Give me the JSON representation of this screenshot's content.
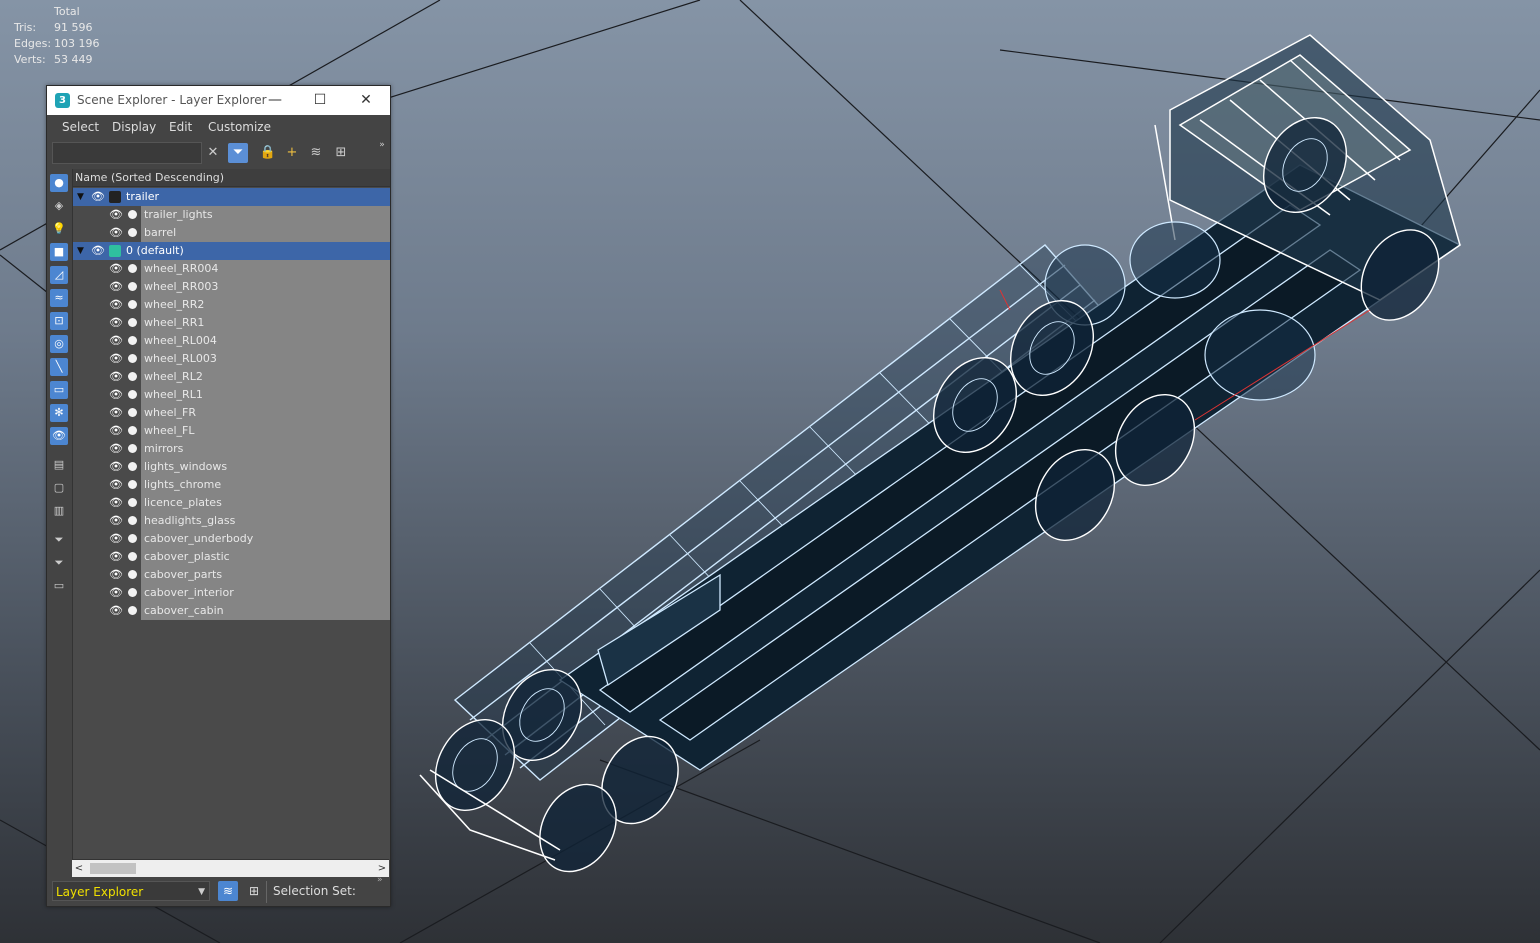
{
  "stats": {
    "header": "Total",
    "rows": [
      {
        "label": "Tris:",
        "value": "91 596"
      },
      {
        "label": "Edges:",
        "value": "103 196"
      },
      {
        "label": "Verts:",
        "value": "53 449"
      }
    ]
  },
  "window": {
    "app_icon_glyph": "3",
    "title": "Scene Explorer - Layer Explorer",
    "minimize_glyph": "—",
    "maximize_glyph": "☐",
    "close_glyph": "✕"
  },
  "menu": [
    "Select",
    "Display",
    "Edit",
    "Customize"
  ],
  "toolbar": {
    "clear_glyph": "✕",
    "filter_glyph": "⏷",
    "lock_glyph": "🔒",
    "add_glyph": "+",
    "layers_glyph": "≋",
    "hierarchy_glyph": "⊞",
    "more_glyph": "»"
  },
  "left_strip": [
    {
      "icon": "geometry-icon",
      "glyph": "●",
      "on": true
    },
    {
      "icon": "shapes-icon",
      "glyph": "◈",
      "on": false
    },
    {
      "icon": "lights-icon",
      "glyph": "💡",
      "on": false
    },
    {
      "icon": "cameras-icon",
      "glyph": "■",
      "on": true
    },
    {
      "icon": "helpers-icon",
      "glyph": "◿",
      "on": true
    },
    {
      "icon": "spacewarps-icon",
      "glyph": "≈",
      "on": true
    },
    {
      "icon": "groups-icon",
      "glyph": "⊡",
      "on": true
    },
    {
      "icon": "xrefs-icon",
      "glyph": "◎",
      "on": true
    },
    {
      "icon": "bones-icon",
      "glyph": "╲",
      "on": true
    },
    {
      "icon": "containers-icon",
      "glyph": "▭",
      "on": true
    },
    {
      "icon": "frozen-icon",
      "glyph": "✻",
      "on": true
    },
    {
      "icon": "hidden-icon",
      "glyph": "👁",
      "on": true
    },
    {
      "icon": "display-all-icon",
      "glyph": "▤",
      "on": false
    },
    {
      "icon": "display-none-icon",
      "glyph": "▢",
      "on": false
    },
    {
      "icon": "invert-icon",
      "glyph": "▥",
      "on": false
    },
    {
      "icon": "filter-settings-icon",
      "glyph": "⏷",
      "on": false
    },
    {
      "icon": "filter-icon",
      "glyph": "⏷",
      "on": false
    },
    {
      "icon": "selection-set-icon",
      "glyph": "▭",
      "on": false
    }
  ],
  "list": {
    "column_header": "Name (Sorted Descending)",
    "rows": [
      {
        "type": "layer",
        "name": "trailer",
        "icon": "layer-stack-dark"
      },
      {
        "type": "obj",
        "name": "trailer_lights"
      },
      {
        "type": "obj",
        "name": "barrel"
      },
      {
        "type": "layer",
        "name": "0 (default)",
        "icon": "layer-stack-active"
      },
      {
        "type": "obj",
        "name": "wheel_RR004"
      },
      {
        "type": "obj",
        "name": "wheel_RR003"
      },
      {
        "type": "obj",
        "name": "wheel_RR2"
      },
      {
        "type": "obj",
        "name": "wheel_RR1"
      },
      {
        "type": "obj",
        "name": "wheel_RL004"
      },
      {
        "type": "obj",
        "name": "wheel_RL003"
      },
      {
        "type": "obj",
        "name": "wheel_RL2"
      },
      {
        "type": "obj",
        "name": "wheel_RL1"
      },
      {
        "type": "obj",
        "name": "wheel_FR"
      },
      {
        "type": "obj",
        "name": "wheel_FL"
      },
      {
        "type": "obj",
        "name": "mirrors"
      },
      {
        "type": "obj",
        "name": "lights_windows"
      },
      {
        "type": "obj",
        "name": "lights_chrome"
      },
      {
        "type": "obj",
        "name": "licence_plates"
      },
      {
        "type": "obj",
        "name": "headlights_glass"
      },
      {
        "type": "obj",
        "name": "cabover_underbody"
      },
      {
        "type": "obj",
        "name": "cabover_plastic"
      },
      {
        "type": "obj",
        "name": "cabover_parts"
      },
      {
        "type": "obj",
        "name": "cabover_interior"
      },
      {
        "type": "obj",
        "name": "cabover_cabin"
      }
    ],
    "eye_glyph": "👁",
    "expand_glyph": "▼"
  },
  "scrollbar": {
    "left_glyph": "<",
    "right_glyph": ">"
  },
  "bottom": {
    "explorer_select_value": "Layer Explorer",
    "caret_glyph": "▼",
    "layers_glyph": "≋",
    "hierarchy_glyph": "⊞",
    "selection_set_label": "Selection Set:",
    "more_glyph": "»"
  },
  "colors": {
    "wire": "#cfe9ff",
    "cab_wire": "#ffffff",
    "selection_blue": "#3d66a8",
    "accent_blue": "#4c86d1",
    "viewport_grid": "#1a1c20"
  }
}
